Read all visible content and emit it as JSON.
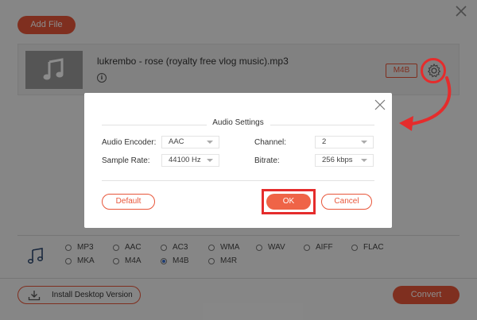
{
  "window": {
    "close_icon": "close-icon"
  },
  "toolbar": {
    "add_file_label": "Add File"
  },
  "file": {
    "name": "lukrembo - rose (royalty free vlog music).mp3",
    "format_label": "M4B",
    "thumbnail_icon": "music-note-icon",
    "settings_icon": "gear-icon",
    "info_icon": "info-icon"
  },
  "dialog": {
    "title": "Audio Settings",
    "fields": {
      "audio_encoder": {
        "label": "Audio Encoder:",
        "value": "AAC"
      },
      "channel": {
        "label": "Channel:",
        "value": "2"
      },
      "sample_rate": {
        "label": "Sample Rate:",
        "value": "44100 Hz"
      },
      "bitrate": {
        "label": "Bitrate:",
        "value": "256 kbps"
      }
    },
    "buttons": {
      "default": "Default",
      "ok": "OK",
      "cancel": "Cancel"
    }
  },
  "formats": {
    "row1": [
      "MP3",
      "AAC",
      "AC3",
      "WMA",
      "WAV",
      "AIFF",
      "FLAC"
    ],
    "row2": [
      "MKA",
      "M4A",
      "M4B",
      "M4R"
    ],
    "selected": "M4B"
  },
  "footer": {
    "install_label": "Install Desktop Version",
    "convert_label": "Convert"
  },
  "colors": {
    "accent": "#e8563a",
    "annotation_red": "#e52c2c"
  }
}
